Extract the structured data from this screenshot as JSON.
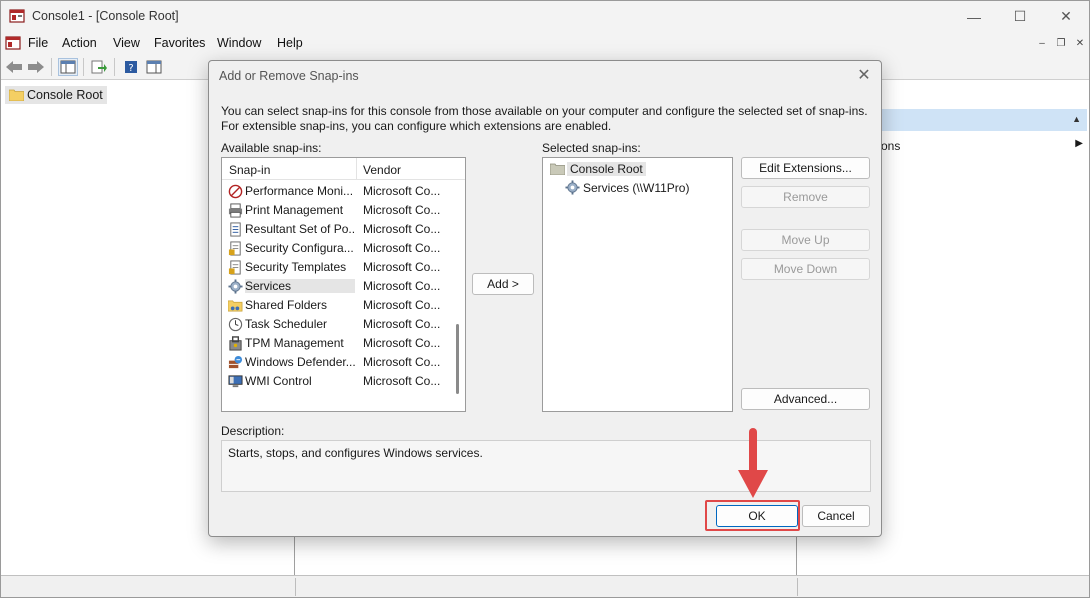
{
  "window": {
    "title": "Console1 - [Console Root]",
    "minimize": "—",
    "maximize": "☐",
    "close": "✕"
  },
  "menu": {
    "items": [
      "File",
      "Action",
      "View",
      "Favorites",
      "Window",
      "Help"
    ],
    "mdi_minimize": "‒",
    "mdi_restore": "❐",
    "mdi_close": "✕"
  },
  "tree": {
    "root_label": "Console Root"
  },
  "actions": {
    "more_label": "ons"
  },
  "dialog": {
    "title": "Add or Remove Snap-ins",
    "close": "✕",
    "intro": "You can select snap-ins for this console from those available on your computer and configure the selected set of snap-ins. For extensible snap-ins, you can configure which extensions are enabled.",
    "available_label": "Available snap-ins:",
    "col_snapin": "Snap-in",
    "col_vendor": "Vendor",
    "snapins": [
      {
        "name": "Performance Moni...",
        "vendor": "Microsoft Co...",
        "icon": "performance-icon"
      },
      {
        "name": "Print Management",
        "vendor": "Microsoft Co...",
        "icon": "printer-icon"
      },
      {
        "name": "Resultant Set of Po...",
        "vendor": "Microsoft Co...",
        "icon": "document-icon"
      },
      {
        "name": "Security Configura...",
        "vendor": "Microsoft Co...",
        "icon": "security-doc-icon"
      },
      {
        "name": "Security Templates",
        "vendor": "Microsoft Co...",
        "icon": "security-doc-icon"
      },
      {
        "name": "Services",
        "vendor": "Microsoft Co...",
        "icon": "gear-icon",
        "selected": true
      },
      {
        "name": "Shared Folders",
        "vendor": "Microsoft Co...",
        "icon": "shared-folder-icon"
      },
      {
        "name": "Task Scheduler",
        "vendor": "Microsoft Co...",
        "icon": "clock-icon"
      },
      {
        "name": "TPM Management",
        "vendor": "Microsoft Co...",
        "icon": "tpm-icon"
      },
      {
        "name": "Windows Defender...",
        "vendor": "Microsoft Co...",
        "icon": "firewall-icon"
      },
      {
        "name": "WMI Control",
        "vendor": "Microsoft Co...",
        "icon": "computer-icon"
      }
    ],
    "add_button": "Add >",
    "selected_label": "Selected snap-ins:",
    "selected_root": "Console Root",
    "selected_child": "Services (\\\\W11Pro)",
    "buttons": {
      "edit_extensions": "Edit Extensions...",
      "remove": "Remove",
      "move_up": "Move Up",
      "move_down": "Move Down",
      "advanced": "Advanced...",
      "ok": "OK",
      "cancel": "Cancel"
    },
    "description_label": "Description:",
    "description": "Starts, stops, and configures Windows services."
  },
  "colors": {
    "highlight": "#e04848",
    "arrow": "#e04848",
    "selection": "#e5e5e5",
    "actions_header": "#cfe3f6"
  }
}
